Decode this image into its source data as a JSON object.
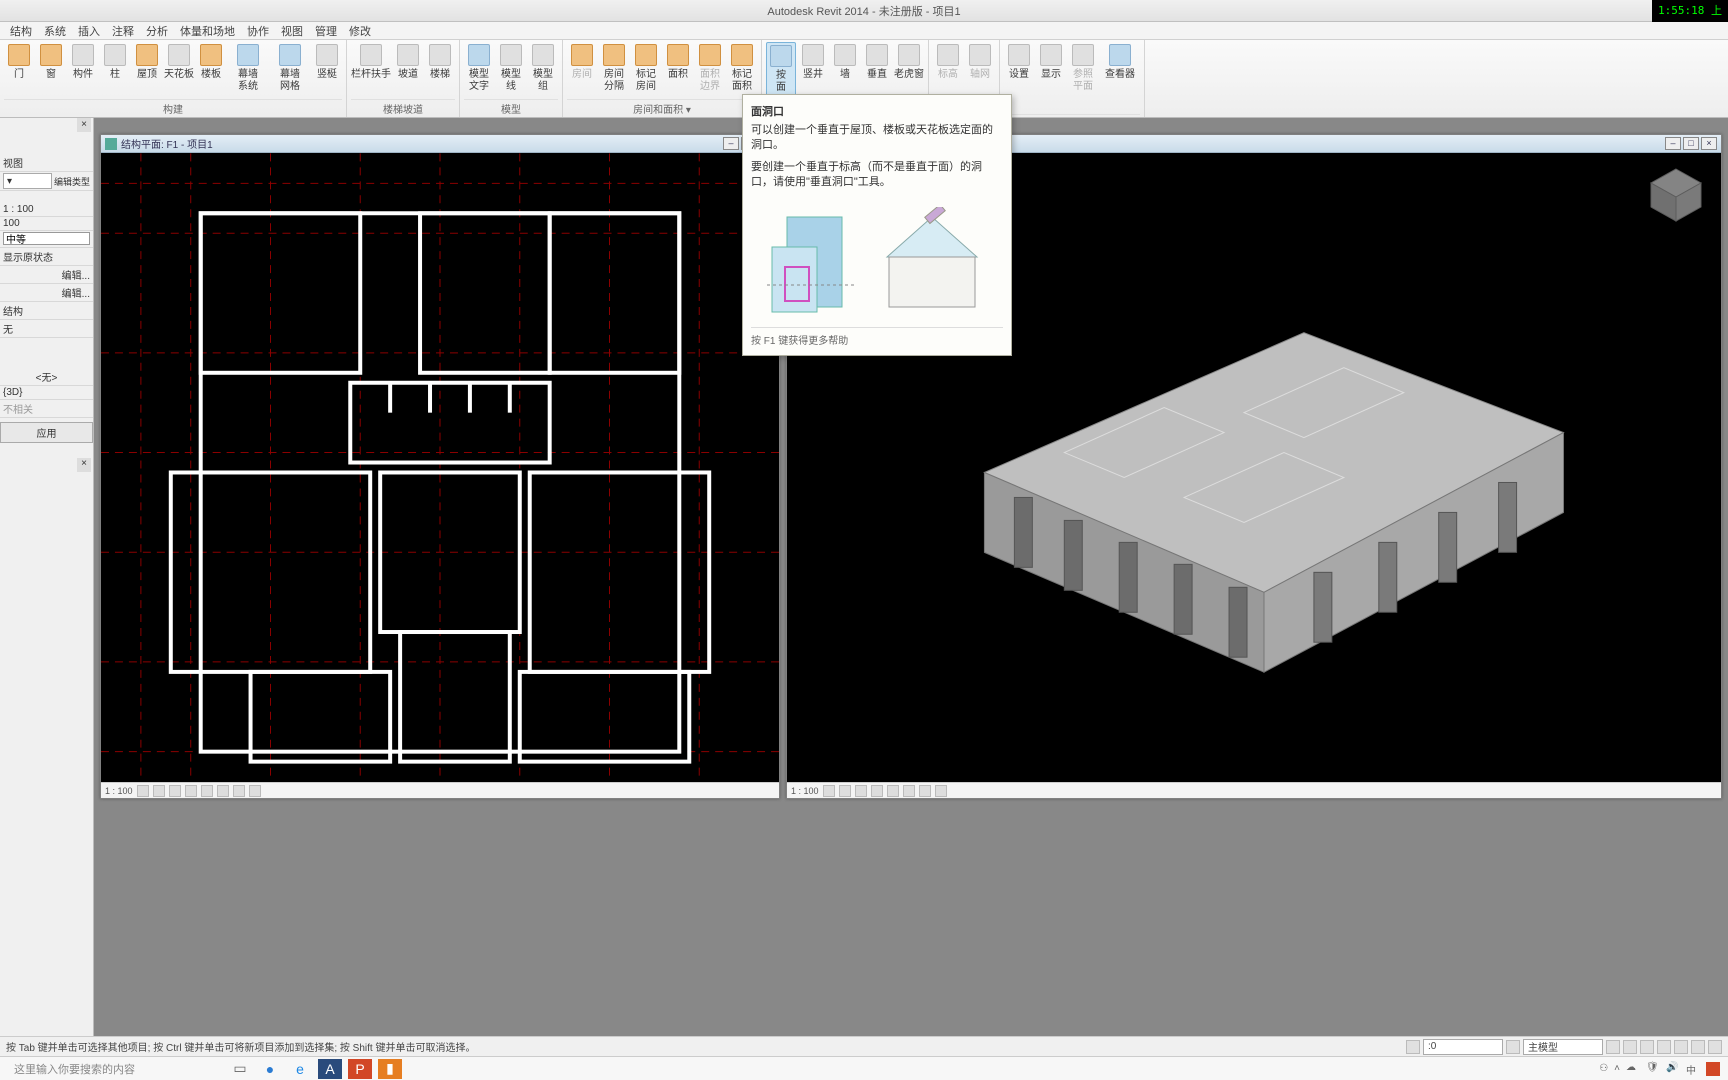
{
  "app": {
    "title": "Autodesk Revit 2014 - 未注册版 -   项目1",
    "clock": "1:55:18 上"
  },
  "tabs": [
    "结构",
    "系统",
    "插入",
    "注释",
    "分析",
    "体量和场地",
    "协作",
    "视图",
    "管理",
    "修改"
  ],
  "ribbon": {
    "groups": [
      {
        "label": "构建",
        "buttons": [
          {
            "t": "门",
            "ic": "orange"
          },
          {
            "t": "窗",
            "ic": "orange"
          },
          {
            "t": "构件",
            "ic": "gray"
          },
          {
            "t": "柱",
            "ic": "gray"
          },
          {
            "t": "屋顶",
            "ic": "orange"
          },
          {
            "t": "天花板",
            "ic": "gray"
          },
          {
            "t": "楼板",
            "ic": "orange"
          },
          {
            "t": "幕墙\n系统",
            "ic": "blue",
            "w": true
          },
          {
            "t": "幕墙\n网格",
            "ic": "blue",
            "w": true
          },
          {
            "t": "竖梃",
            "ic": "gray"
          }
        ]
      },
      {
        "label": "楼梯坡道",
        "buttons": [
          {
            "t": "栏杆扶手",
            "ic": "gray",
            "w": true
          },
          {
            "t": "坡道",
            "ic": "gray"
          },
          {
            "t": "楼梯",
            "ic": "gray"
          }
        ]
      },
      {
        "label": "模型",
        "buttons": [
          {
            "t": "模型\n文字",
            "ic": "blue"
          },
          {
            "t": "模型\n线",
            "ic": "gray"
          },
          {
            "t": "模型\n组",
            "ic": "gray"
          }
        ]
      },
      {
        "label": "房间和面积 ▾",
        "buttons": [
          {
            "t": "房间",
            "ic": "orange",
            "d": true
          },
          {
            "t": "房间\n分隔",
            "ic": "orange"
          },
          {
            "t": "标记\n房间",
            "ic": "orange"
          },
          {
            "t": "面积",
            "ic": "orange"
          },
          {
            "t": "面积\n边界",
            "ic": "orange",
            "d": true
          },
          {
            "t": "标记\n面积",
            "ic": "orange"
          }
        ]
      },
      {
        "label": "",
        "buttons": [
          {
            "t": "按\n面",
            "ic": "blue",
            "active": true
          },
          {
            "t": "竖井",
            "ic": "gray"
          },
          {
            "t": "墙",
            "ic": "gray"
          },
          {
            "t": "垂直",
            "ic": "gray"
          },
          {
            "t": "老虎窗",
            "ic": "gray"
          }
        ]
      },
      {
        "label": "",
        "buttons": [
          {
            "t": "标高",
            "ic": "gray",
            "d": true
          },
          {
            "t": "轴网",
            "ic": "gray",
            "d": true
          }
        ]
      },
      {
        "label": "",
        "buttons": [
          {
            "t": "设置",
            "ic": "gray"
          },
          {
            "t": "显示",
            "ic": "gray"
          },
          {
            "t": "参照\n平面",
            "ic": "gray",
            "d": true
          },
          {
            "t": "查看器",
            "ic": "blue",
            "w": true
          }
        ]
      }
    ]
  },
  "tooltip": {
    "title": "面洞口",
    "desc": "可以创建一个垂直于屋顶、楼板或天花板选定面的洞口。",
    "note": "要创建一个垂直于标高（而不是垂直于面）的洞口，请使用\"垂直洞口\"工具。",
    "help": "按 F1 键获得更多帮助"
  },
  "left_panel": {
    "header": "视图",
    "edit_type": "编辑类型",
    "scale": "1 : 100",
    "scale_val": "100",
    "detail": "中等",
    "show_orig": "显示原状态",
    "edit1": "编辑...",
    "edit2": "编辑...",
    "struct": "结构",
    "none": "无",
    "none2": "<无>",
    "td": "{3D}",
    "unrel": "不相关",
    "apply": "应用"
  },
  "doc_plan": {
    "title": "结构平面: F1 - 项目1",
    "scale": "1 : 100"
  },
  "doc_3d": {
    "scale": "1 : 100"
  },
  "statusbar": {
    "text": "按 Tab 键并单击可选择其他项目; 按 Ctrl 键并单击可将新项目添加到选择集; 按 Shift 键并单击可取消选择。",
    "ws": "主模型",
    "zero": ":0"
  },
  "taskbar": {
    "search": "这里输入你要搜索的内容"
  }
}
